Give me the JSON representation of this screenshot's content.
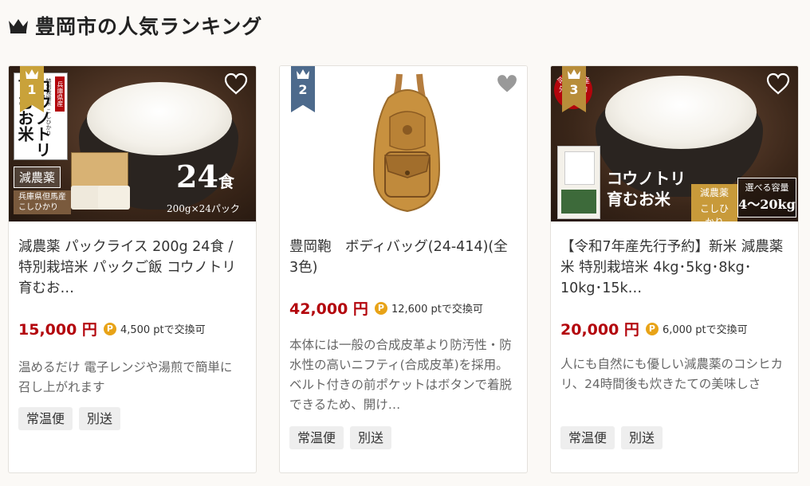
{
  "header": {
    "title": "豊岡市の人気ランキング",
    "icon": "crown-icon"
  },
  "colors": {
    "price": "#b3050c",
    "rank1": "#c9a23a",
    "rank2": "#4d6a8c",
    "rank3": "#b88d3a",
    "points": "#e8a317"
  },
  "products": [
    {
      "rank": "1",
      "title": "減農薬 パックライス 200g 24食 / 特別栽培米 パックご飯 コウノトリ育むお…",
      "price": "15,000 円",
      "points": "4,500 ptで交換可",
      "description": "温めるだけ 電子レンジや湯煎で簡単に召し上がれます",
      "tags": [
        "常温便",
        "別送"
      ],
      "image_text": {
        "prefecture": "兵庫県産",
        "brand": "特別栽培米 こしひかり",
        "name": "コウノトリ育むお米",
        "badge": "減農薬",
        "origin": "兵庫県但馬産 こしひかり",
        "count": "24",
        "unit": "食",
        "pack": "200g×24パック"
      }
    },
    {
      "rank": "2",
      "title": "豊岡鞄　ボディバッグ(24-414)(全3色)",
      "price": "42,000 円",
      "points": "12,600 ptで交換可",
      "description": "本体には一般の合成皮革より防汚性・防水性の高いニフティ(合成皮革)を採用。ベルト付きの前ポケットはボタンで着脱できるため、開け…",
      "tags": [
        "常温便",
        "別送"
      ]
    },
    {
      "rank": "3",
      "title": "【令和7年産先行予約】新米 減農薬 米 特別栽培米 4kg･5kg･8kg･10kg･15k…",
      "price": "20,000 円",
      "points": "6,000 ptで交換可",
      "description": "人にも自然にも優しい減農薬のコシヒカリ、24時間後も炊きたての美味しさ",
      "tags": [
        "常温便",
        "別送"
      ],
      "image_text": {
        "badge": "令和7年産 先行予約",
        "name1": "コウノトリ",
        "name2": "育むお米",
        "tag1": "減農薬",
        "tag2": "こしひかり",
        "capacity_label": "選べる容量",
        "capacity": "4～20kg"
      }
    }
  ]
}
